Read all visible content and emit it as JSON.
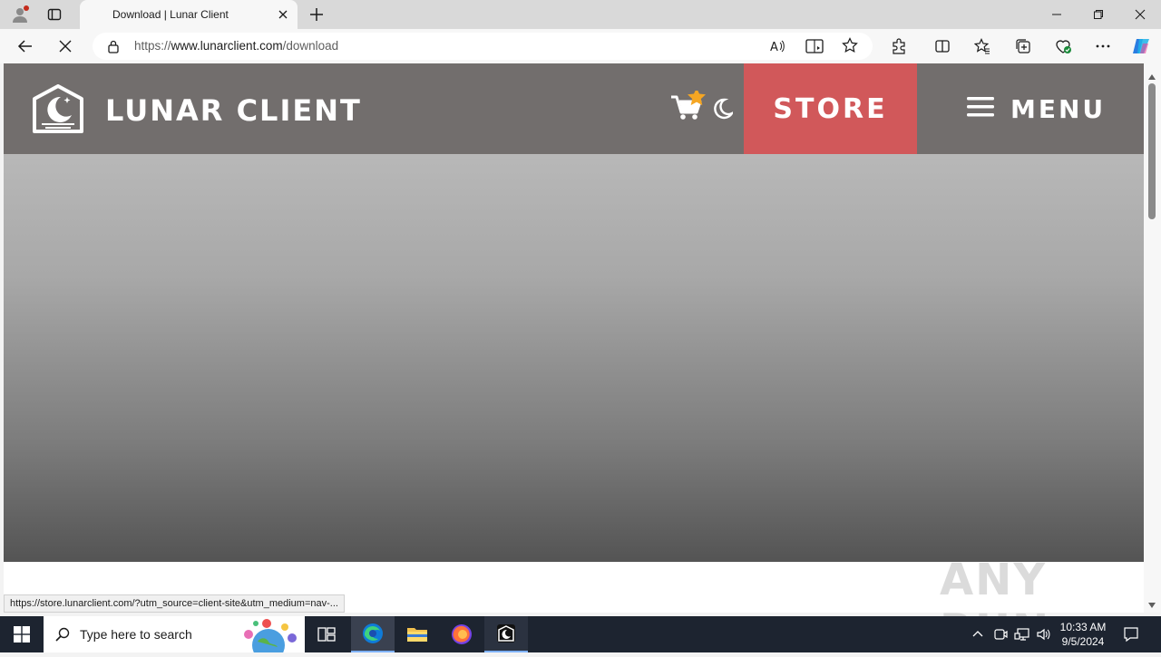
{
  "browser": {
    "tab_title": "Download | Lunar Client",
    "url_prefix": "https://",
    "url_host": "www.lunarclient.com",
    "url_path": "/download",
    "status_url": "https://store.lunarclient.com/?utm_source=client-site&utm_medium=nav-..."
  },
  "site": {
    "logo_text": "LUNAR CLIENT",
    "store_label": "STORE",
    "menu_label": "MENU",
    "header_color": "#726e6d",
    "store_color": "#d1585a"
  },
  "watermark": "ANY RUN",
  "taskbar": {
    "search_placeholder": "Type here to search",
    "time": "10:33 AM",
    "date": "9/5/2024"
  }
}
